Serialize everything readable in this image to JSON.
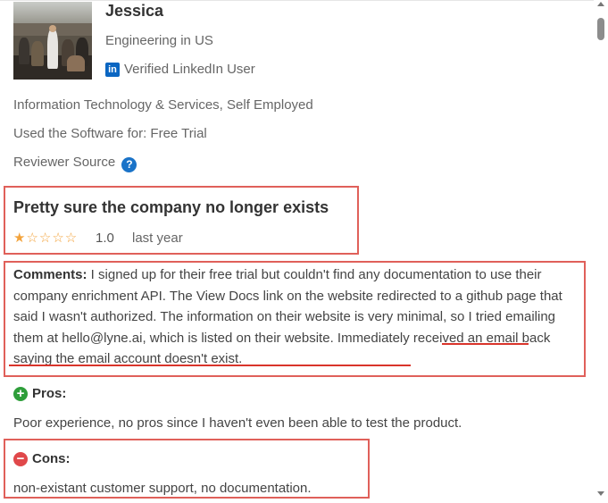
{
  "reviewer": {
    "name": "Jessica",
    "role": "Engineering in US",
    "linkedin_icon_glyph": "in",
    "verification": "Verified LinkedIn User",
    "industry": "Information Technology & Services, Self Employed",
    "usage": "Used the Software for: Free Trial",
    "source": "Reviewer Source",
    "help_glyph": "?"
  },
  "review": {
    "title": "Pretty sure the company no longer exists",
    "stars": "★☆☆☆☆",
    "rating_value": 1,
    "rating": "1.0",
    "time": "last year",
    "comments_label": "Comments:",
    "comments_text": " I signed up for their free trial but couldn't find any documentation to use their company enrichment API. The View Docs link on the website redirected to a github page that said I wasn't authorized. The information on their website is very minimal, so I tried emailing them at hello@lyne.ai, which is listed on their website. Immediately received an email back saying the email account doesn't exist."
  },
  "pros": {
    "label": "Pros:",
    "icon_glyph": "+",
    "text": "Poor experience, no pros since I haven't even been able to test the product."
  },
  "cons": {
    "label": "Cons:",
    "icon_glyph": "−",
    "text": "non-existant customer support, no documentation."
  },
  "colors": {
    "highlight_box": "#e0605a",
    "star": "#f3a33b",
    "pros_icon": "#2e9e3a",
    "cons_icon": "#e0484a",
    "linkedin": "#0a66c2"
  }
}
